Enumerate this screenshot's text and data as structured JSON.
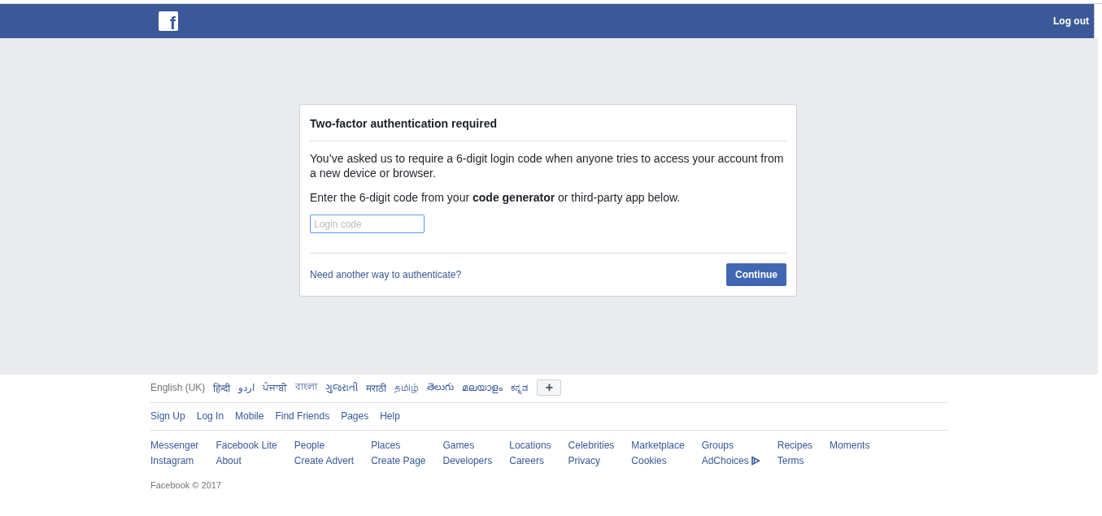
{
  "header": {
    "logo": "f",
    "logout": "Log out"
  },
  "card": {
    "title": "Two-factor authentication required",
    "intro": "You’ve asked us to require a 6-digit login code when anyone tries to access your account from a new device or browser.",
    "instruction": "Enter the 6-digit code from your **code generator** or third-party app below.",
    "field": {
      "placeholder": "Login code"
    },
    "help_link": "Need another way to authenticate?",
    "button": "Continue"
  },
  "languages": [
    {
      "label": "English (UK)",
      "selected": true
    },
    {
      "label": "हिन्दी",
      "selected": false
    },
    {
      "label": "اردو",
      "selected": false
    },
    {
      "label": "ਪੰਜਾਬੀ",
      "selected": false
    },
    {
      "label": "বাংলা",
      "selected": false
    },
    {
      "label": "ગુજરાતી",
      "selected": false
    },
    {
      "label": "मराठी",
      "selected": false
    },
    {
      "label": "தமிழ்",
      "selected": false
    },
    {
      "label": "తెలుగు",
      "selected": false
    },
    {
      "label": "മലയാളം",
      "selected": false
    },
    {
      "label": "ಕನ್ನಡ",
      "selected": false
    }
  ],
  "more_languages": "+",
  "primary_links": [
    "Sign Up",
    "Log In",
    "Mobile",
    "Find Friends",
    "Pages",
    "Help"
  ],
  "link_columns": [
    [
      "Messenger",
      "Instagram"
    ],
    [
      "Facebook Lite",
      "About"
    ],
    [
      "People",
      "Create Advert"
    ],
    [
      "Places",
      "Create Page"
    ],
    [
      "Games",
      "Developers"
    ],
    [
      "Locations",
      "Careers"
    ],
    [
      "Celebrities",
      "Privacy"
    ],
    [
      "Marketplace",
      "Cookies"
    ],
    [
      "Groups",
      {
        "label": "AdChoices",
        "kind": "adchoices"
      }
    ],
    [
      "Recipes",
      "Terms"
    ],
    [
      "Moments"
    ]
  ],
  "copyright": "Facebook © 2017"
}
